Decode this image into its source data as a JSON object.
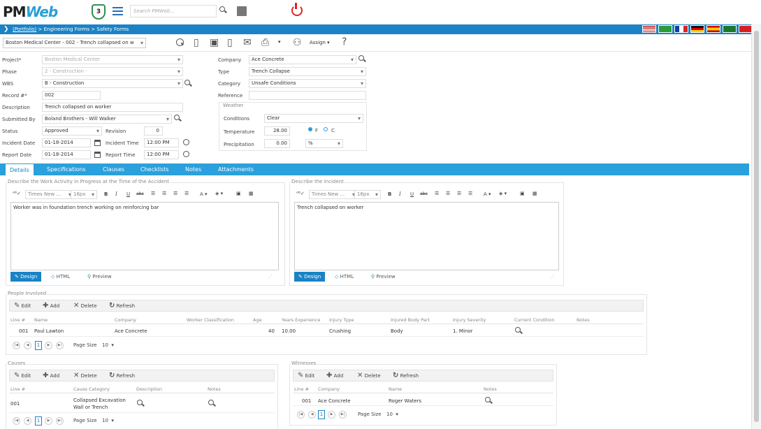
{
  "app": {
    "logo_text_pm": "PM",
    "logo_text_web": "Web",
    "shield_number": "3",
    "search_placeholder": "Search PMWeb..."
  },
  "breadcrumb": {
    "root": "(Portfolio)",
    "rest": " > Engineering Forms > Safety Forms"
  },
  "languages": [
    "english",
    "portuguese",
    "french",
    "german",
    "spanish",
    "arabic",
    "chinese"
  ],
  "toolbar": {
    "record_selector": "Boston Medical Center - 002 - Trench collapsed on w",
    "assign_label": "Assign",
    "help_label": "?"
  },
  "form": {
    "project": {
      "label": "Project*",
      "value": "Boston Medical Center"
    },
    "phase": {
      "label": "Phase",
      "value": "2 - Construction -"
    },
    "wbs": {
      "label": "WBS",
      "value": "B - Construction"
    },
    "record": {
      "label": "Record #*",
      "value": "002"
    },
    "description": {
      "label": "Description",
      "value": "Trench collapsed on worker"
    },
    "submitted_by": {
      "label": "Submitted By",
      "value": "Boland Brothers - Will Walker"
    },
    "status": {
      "label": "Status",
      "value": "Approved"
    },
    "revision": {
      "label": "Revision",
      "value": "0"
    },
    "incident_date": {
      "label": "Incident Date",
      "value": "01-18-2014"
    },
    "incident_time": {
      "label": "Incident Time",
      "value": "12:00 PM"
    },
    "report_date": {
      "label": "Report Date",
      "value": "01-18-2014"
    },
    "report_time": {
      "label": "Report Time",
      "value": "12:00 PM"
    },
    "company": {
      "label": "Company",
      "value": "Ace Concrete"
    },
    "type": {
      "label": "Type",
      "value": "Trench Collapse"
    },
    "category": {
      "label": "Category",
      "value": "Unsafe Conditions"
    },
    "reference": {
      "label": "Reference",
      "value": ""
    },
    "weather": {
      "legend": "Weather",
      "conditions": {
        "label": "Conditions",
        "value": "Clear"
      },
      "temperature": {
        "label": "Temperature",
        "value": "28.00",
        "unit_f": "F",
        "unit_c": "C",
        "selected_unit": "F"
      },
      "precipitation": {
        "label": "Precipitation",
        "value": "0.00",
        "unit": "%"
      }
    }
  },
  "tabs": [
    {
      "label": "Details",
      "active": true
    },
    {
      "label": "Specifications"
    },
    {
      "label": "Clauses"
    },
    {
      "label": "Checklists"
    },
    {
      "label": "Notes"
    },
    {
      "label": "Attachments"
    }
  ],
  "editors": {
    "work_activity": {
      "legend": "Describe the Work Activity in Progress at the Time of the Accident",
      "content": "Worker was in foundation trench working on reinforcing bar"
    },
    "incident": {
      "legend": "Describe the Incident",
      "content": "Trench collapsed on worker"
    },
    "toolbar": {
      "font": "Times New ...",
      "size": "16px",
      "bold": "B",
      "italic": "I",
      "underline": "U",
      "strike": "abc",
      "color": "A"
    },
    "modes": {
      "design": "Design",
      "html": "HTML",
      "preview": "Preview"
    }
  },
  "grid_buttons": {
    "edit": "Edit",
    "add": "Add",
    "delete": "Delete",
    "refresh": "Refresh"
  },
  "pager": {
    "current_page": "1",
    "page_size_label": "Page Size",
    "page_size": "10"
  },
  "people": {
    "legend": "People Involved",
    "columns": [
      "Line #",
      "Name",
      "Company",
      "Worker Classification",
      "Age",
      "Years Experience",
      "Injury Type",
      "Injured Body Part",
      "Injury Severity",
      "Current Condition",
      "Notes"
    ],
    "rows": [
      {
        "line": "001",
        "name": "Paul Lawton",
        "company": "Ace Concrete",
        "classification": "",
        "age": "40",
        "years": "10.00",
        "injury_type": "Crushing",
        "body_part": "Body",
        "severity": "1. Minor"
      }
    ]
  },
  "causes": {
    "legend": "Causes",
    "columns": [
      "Line #",
      "Cause Category",
      "Description",
      "Notes"
    ],
    "rows": [
      {
        "line": "001",
        "category_line1": "Collapsed Excavation",
        "category_line2": "Wall or Trench"
      }
    ]
  },
  "witnesses": {
    "legend": "Witnesses",
    "columns": [
      "Line #",
      "Company",
      "Name",
      "Notes"
    ],
    "rows": [
      {
        "line": "001",
        "company": "Ace Concrete",
        "name": "Roger Waters"
      }
    ]
  }
}
